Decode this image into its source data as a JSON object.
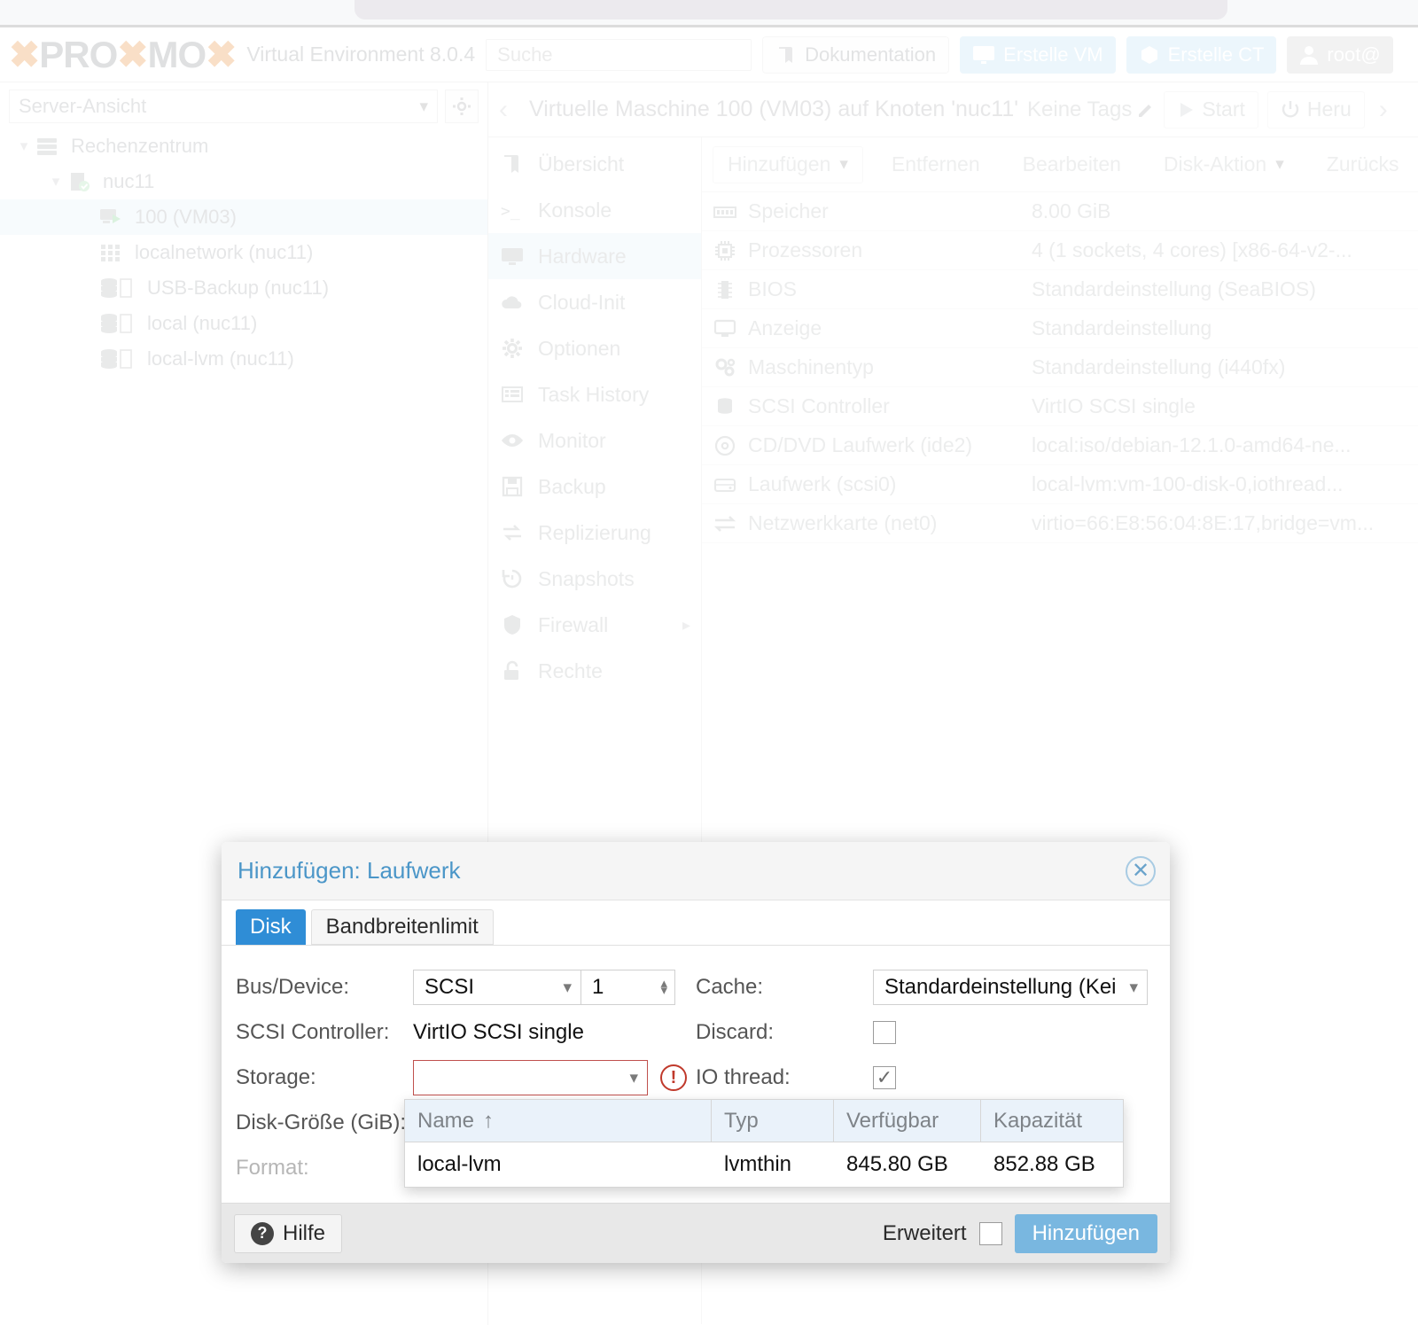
{
  "header": {
    "brand_x": "X",
    "brand_name": "PROXMOX",
    "version": "Virtual Environment 8.0.4",
    "search_placeholder": "Suche",
    "documentation": "Dokumentation",
    "create_vm": "Erstelle VM",
    "create_ct": "Erstelle CT",
    "user": "root@",
    "accent_orange": "#e57000",
    "accent_blue": "#2f8dd6"
  },
  "sidebar": {
    "view_select": "Server-Ansicht",
    "tree": [
      {
        "label": "Rechenzentrum",
        "icon": "datacenter-icon",
        "depth": 0,
        "selected": false
      },
      {
        "label": "nuc11",
        "icon": "node-icon",
        "depth": 1,
        "selected": false
      },
      {
        "label": "100 (VM03)",
        "icon": "vm-running-icon",
        "depth": 2,
        "selected": true
      },
      {
        "label": "localnetwork (nuc11)",
        "icon": "network-icon",
        "depth": 2,
        "selected": false
      },
      {
        "label": "USB-Backup (nuc11)",
        "icon": "storage-icon",
        "depth": 2,
        "selected": false
      },
      {
        "label": "local (nuc11)",
        "icon": "storage-icon",
        "depth": 2,
        "selected": false
      },
      {
        "label": "local-lvm (nuc11)",
        "icon": "storage-icon",
        "depth": 2,
        "selected": false
      }
    ]
  },
  "vm_panel": {
    "breadcrumb": "Virtuelle Maschine 100 (VM03) auf Knoten 'nuc11'",
    "tags": "Keine Tags",
    "start_button": "Start",
    "shutdown_button": "Heru",
    "nav": [
      {
        "label": "Übersicht",
        "icon": "overview-icon",
        "active": false,
        "submenu": false
      },
      {
        "label": "Konsole",
        "icon": "console-icon",
        "active": false,
        "submenu": false
      },
      {
        "label": "Hardware",
        "icon": "monitor-icon",
        "active": true,
        "submenu": false
      },
      {
        "label": "Cloud-Init",
        "icon": "cloud-icon",
        "active": false,
        "submenu": false
      },
      {
        "label": "Optionen",
        "icon": "gear-icon",
        "active": false,
        "submenu": false
      },
      {
        "label": "Task History",
        "icon": "list-icon",
        "active": false,
        "submenu": false
      },
      {
        "label": "Monitor",
        "icon": "eye-icon",
        "active": false,
        "submenu": false
      },
      {
        "label": "Backup",
        "icon": "floppy-icon",
        "active": false,
        "submenu": false
      },
      {
        "label": "Replizierung",
        "icon": "replication-icon",
        "active": false,
        "submenu": false
      },
      {
        "label": "Snapshots",
        "icon": "history-icon",
        "active": false,
        "submenu": false
      },
      {
        "label": "Firewall",
        "icon": "shield-icon",
        "active": false,
        "submenu": true
      },
      {
        "label": "Rechte",
        "icon": "unlock-icon",
        "active": false,
        "submenu": false
      }
    ],
    "toolbar": {
      "add": "Hinzufügen",
      "remove": "Entfernen",
      "edit": "Bearbeiten",
      "disk_action": "Disk-Aktion",
      "revert": "Zurücks"
    },
    "hardware": [
      {
        "icon": "memory-icon",
        "key": "Speicher",
        "value": "8.00 GiB"
      },
      {
        "icon": "cpu-icon",
        "key": "Prozessoren",
        "value": "4 (1 sockets, 4 cores) [x86-64-v2-..."
      },
      {
        "icon": "bios-icon",
        "key": "BIOS",
        "value": "Standardeinstellung (SeaBIOS)"
      },
      {
        "icon": "display-icon",
        "key": "Anzeige",
        "value": "Standardeinstellung"
      },
      {
        "icon": "machine-icon",
        "key": "Maschinentyp",
        "value": "Standardeinstellung (i440fx)"
      },
      {
        "icon": "controller-icon",
        "key": "SCSI Controller",
        "value": "VirtIO SCSI single"
      },
      {
        "icon": "cd-icon",
        "key": "CD/DVD Laufwerk (ide2)",
        "value": "local:iso/debian-12.1.0-amd64-ne..."
      },
      {
        "icon": "disk-icon",
        "key": "Laufwerk (scsi0)",
        "value": "local-lvm:vm-100-disk-0,iothread..."
      },
      {
        "icon": "nic-icon",
        "key": "Netzwerkkarte (net0)",
        "value": "virtio=66:E8:56:04:8E:17,bridge=vm..."
      }
    ]
  },
  "dialog": {
    "title": "Hinzufügen: Laufwerk",
    "close_icon": "close-icon",
    "tabs": [
      {
        "label": "Disk",
        "active": true
      },
      {
        "label": "Bandbreitenlimit",
        "active": false
      }
    ],
    "left_fields": {
      "bus_device_label": "Bus/Device:",
      "bus_value": "SCSI",
      "device_number": "1",
      "scsi_controller_label": "SCSI Controller:",
      "scsi_controller_value": "VirtIO SCSI single",
      "storage_label": "Storage:",
      "storage_value": "",
      "storage_invalid": true,
      "disk_size_label": "Disk-Größe (GiB):",
      "format_label": "Format:"
    },
    "right_fields": {
      "cache_label": "Cache:",
      "cache_value": "Standardeinstellung (Kei",
      "discard_label": "Discard:",
      "discard_checked": false,
      "io_thread_label": "IO thread:",
      "io_thread_checked": true
    },
    "storage_dropdown": {
      "columns": [
        "Name",
        "Typ",
        "Verfügbar",
        "Kapazität"
      ],
      "sort_indicator": "↑",
      "rows": [
        {
          "name": "local-lvm",
          "typ": "lvmthin",
          "verfuegbar": "845.80 GB",
          "kapazitaet": "852.88 GB"
        }
      ]
    },
    "footer": {
      "help": "Hilfe",
      "advanced": "Erweitert",
      "advanced_checked": false,
      "submit": "Hinzufügen"
    }
  }
}
